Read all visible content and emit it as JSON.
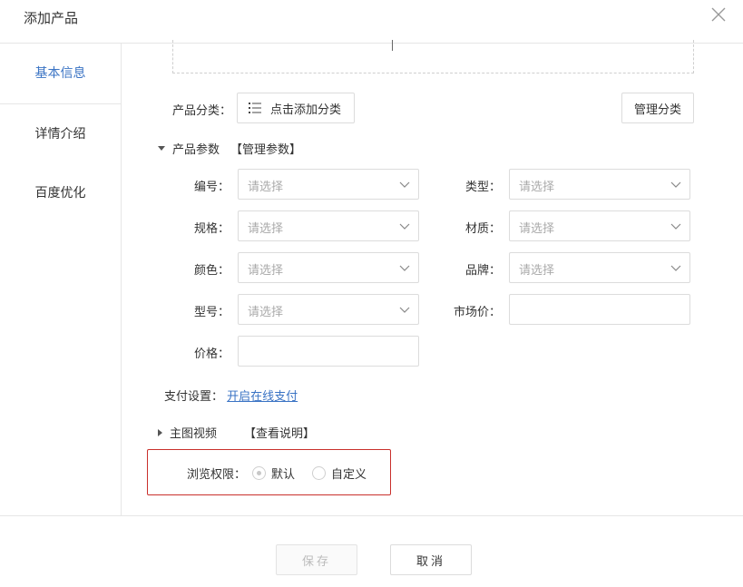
{
  "dialog": {
    "title": "添加产品"
  },
  "sidebar": {
    "items": [
      {
        "label": "基本信息",
        "active": true
      },
      {
        "label": "详情介绍",
        "active": false
      },
      {
        "label": "百度优化",
        "active": false
      }
    ]
  },
  "category": {
    "label": "产品分类：",
    "add_button": "点击添加分类",
    "manage_button": "管理分类"
  },
  "params": {
    "heading": "产品参数",
    "manage_link": "【管理参数】",
    "fields": [
      {
        "label": "编号：",
        "placeholder": "请选择",
        "kind": "select"
      },
      {
        "label": "类型：",
        "placeholder": "请选择",
        "kind": "select"
      },
      {
        "label": "规格：",
        "placeholder": "请选择",
        "kind": "select"
      },
      {
        "label": "材质：",
        "placeholder": "请选择",
        "kind": "select"
      },
      {
        "label": "颜色：",
        "placeholder": "请选择",
        "kind": "select"
      },
      {
        "label": "品牌：",
        "placeholder": "请选择",
        "kind": "select"
      },
      {
        "label": "型号：",
        "placeholder": "请选择",
        "kind": "select"
      },
      {
        "label": "市场价：",
        "value": "",
        "kind": "input"
      },
      {
        "label": "价格：",
        "value": "",
        "kind": "input"
      }
    ]
  },
  "payment": {
    "label": "支付设置：",
    "link": "开启在线支付"
  },
  "media": {
    "heading": "主图视频",
    "help_link": "【查看说明】"
  },
  "permission": {
    "label": "浏览权限：",
    "options": [
      {
        "label": "默认",
        "checked": true
      },
      {
        "label": "自定义",
        "checked": false
      }
    ]
  },
  "footer": {
    "save": "保存",
    "cancel": "取消"
  },
  "colors": {
    "accent": "#3a73c4",
    "highlight_border": "#c9302c"
  }
}
